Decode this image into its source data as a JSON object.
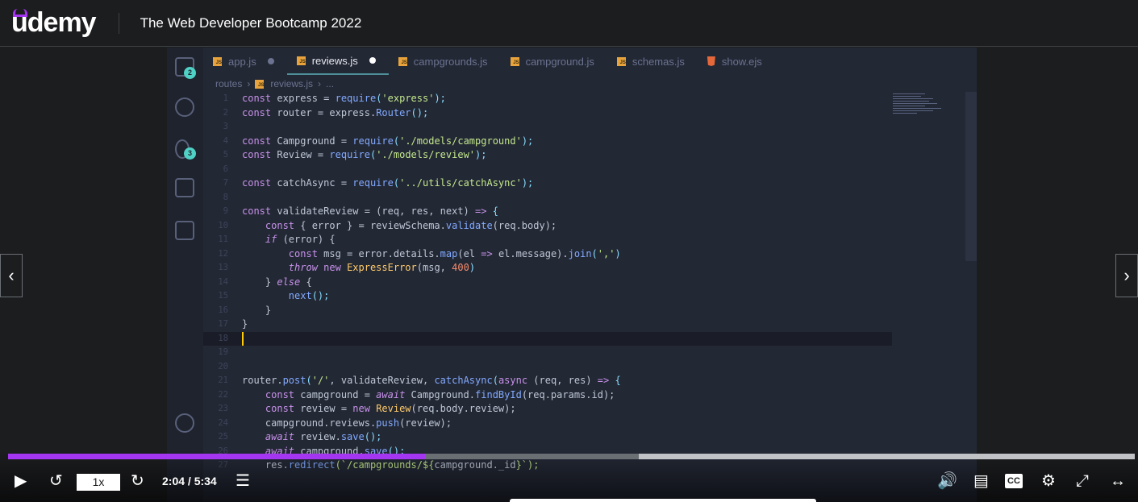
{
  "header": {
    "logo": "udemy",
    "course_title": "The Web Developer Bootcamp 2022"
  },
  "editor": {
    "tabs": [
      {
        "label": "app.js",
        "icon": "js",
        "modified": true
      },
      {
        "label": "reviews.js",
        "icon": "js",
        "modified": true,
        "active": true
      },
      {
        "label": "campgrounds.js",
        "icon": "js"
      },
      {
        "label": "campground.js",
        "icon": "js"
      },
      {
        "label": "schemas.js",
        "icon": "js"
      },
      {
        "label": "show.ejs",
        "icon": "html5"
      }
    ],
    "breadcrumb": [
      "routes",
      "reviews.js",
      "..."
    ],
    "activity_badges": {
      "explorer": "2",
      "source_control": "3"
    },
    "lines": [
      [
        [
          "const ",
          "k"
        ],
        [
          "express = ",
          "t"
        ],
        [
          "require",
          "f"
        ],
        [
          "(",
          "p"
        ],
        [
          "'express'",
          "s"
        ],
        [
          ");",
          "p"
        ]
      ],
      [
        [
          "const ",
          "k"
        ],
        [
          "router = express.",
          "t"
        ],
        [
          "Router",
          "f"
        ],
        [
          "();",
          "p"
        ]
      ],
      [],
      [
        [
          "const ",
          "k"
        ],
        [
          "Campground = ",
          "t"
        ],
        [
          "require",
          "f"
        ],
        [
          "(",
          "p"
        ],
        [
          "'./models/campground'",
          "s"
        ],
        [
          ");",
          "p"
        ]
      ],
      [
        [
          "const ",
          "k"
        ],
        [
          "Review = ",
          "t"
        ],
        [
          "require",
          "f"
        ],
        [
          "(",
          "p"
        ],
        [
          "'./models/review'",
          "s"
        ],
        [
          ");",
          "p"
        ]
      ],
      [],
      [
        [
          "const ",
          "k"
        ],
        [
          "catchAsync = ",
          "t"
        ],
        [
          "require",
          "f"
        ],
        [
          "(",
          "p"
        ],
        [
          "'../utils/catchAsync'",
          "s"
        ],
        [
          ");",
          "p"
        ]
      ],
      [],
      [
        [
          "const ",
          "k"
        ],
        [
          "validateReview = (req, res, next) ",
          "t"
        ],
        [
          "=> ",
          "k"
        ],
        [
          "{",
          "p"
        ]
      ],
      [
        [
          "    const ",
          "k"
        ],
        [
          "{ error } = reviewSchema.",
          "t"
        ],
        [
          "validate",
          "f"
        ],
        [
          "(req.body);",
          "t"
        ]
      ],
      [
        [
          "    if ",
          "i"
        ],
        [
          "(error) {",
          "t"
        ]
      ],
      [
        [
          "        const ",
          "k"
        ],
        [
          "msg = error.details.",
          "t"
        ],
        [
          "map",
          "f"
        ],
        [
          "(el ",
          "t"
        ],
        [
          "=> ",
          "k"
        ],
        [
          "el.message).",
          "t"
        ],
        [
          "join",
          "f"
        ],
        [
          "(",
          "p"
        ],
        [
          "','",
          "s"
        ],
        [
          ")",
          "p"
        ]
      ],
      [
        [
          "        throw ",
          "i"
        ],
        [
          "new ",
          "k"
        ],
        [
          "ExpressError",
          "c"
        ],
        [
          "(msg, ",
          "t"
        ],
        [
          "400",
          "n"
        ],
        [
          ")",
          "p"
        ]
      ],
      [
        [
          "    } ",
          "t"
        ],
        [
          "else ",
          "i"
        ],
        [
          "{",
          "t"
        ]
      ],
      [
        [
          "        next",
          "f"
        ],
        [
          "();",
          "p"
        ]
      ],
      [
        [
          "    }",
          "t"
        ]
      ],
      [
        [
          "}",
          "t"
        ]
      ],
      [],
      [],
      [],
      [
        [
          "router.",
          "t"
        ],
        [
          "post",
          "f"
        ],
        [
          "(",
          "p"
        ],
        [
          "'/'",
          "s"
        ],
        [
          ", validateReview, ",
          "t"
        ],
        [
          "catchAsync",
          "f"
        ],
        [
          "(",
          "p"
        ],
        [
          "async ",
          "k"
        ],
        [
          "(req, res) ",
          "t"
        ],
        [
          "=> ",
          "k"
        ],
        [
          "{",
          "p"
        ]
      ],
      [
        [
          "    const ",
          "k"
        ],
        [
          "campground = ",
          "t"
        ],
        [
          "await ",
          "i"
        ],
        [
          "Campground.",
          "t"
        ],
        [
          "findById",
          "f"
        ],
        [
          "(req.params.id);",
          "t"
        ]
      ],
      [
        [
          "    const ",
          "k"
        ],
        [
          "review = ",
          "t"
        ],
        [
          "new ",
          "k"
        ],
        [
          "Review",
          "c"
        ],
        [
          "(req.body.review);",
          "t"
        ]
      ],
      [
        [
          "    campground.reviews.",
          "t"
        ],
        [
          "push",
          "f"
        ],
        [
          "(review);",
          "t"
        ]
      ],
      [
        [
          "    await ",
          "i"
        ],
        [
          "review.",
          "t"
        ],
        [
          "save",
          "f"
        ],
        [
          "();",
          "p"
        ]
      ],
      [
        [
          "    await ",
          "i"
        ],
        [
          "campground.",
          "t"
        ],
        [
          "save",
          "f"
        ],
        [
          "();",
          "p"
        ]
      ],
      [
        [
          "    res.",
          "t"
        ],
        [
          "redirect",
          "f"
        ],
        [
          "(`/campgrounds/${",
          "s"
        ],
        [
          "campground._id",
          "t"
        ],
        [
          "}`);",
          "s"
        ]
      ]
    ],
    "current_line": 18
  },
  "player": {
    "speed": "1x",
    "current_time": "2:04",
    "duration": "5:34",
    "time_display": "2:04 / 5:34",
    "progress_percent": 37,
    "buffered_percent": 56,
    "accent": "#a435f0"
  }
}
